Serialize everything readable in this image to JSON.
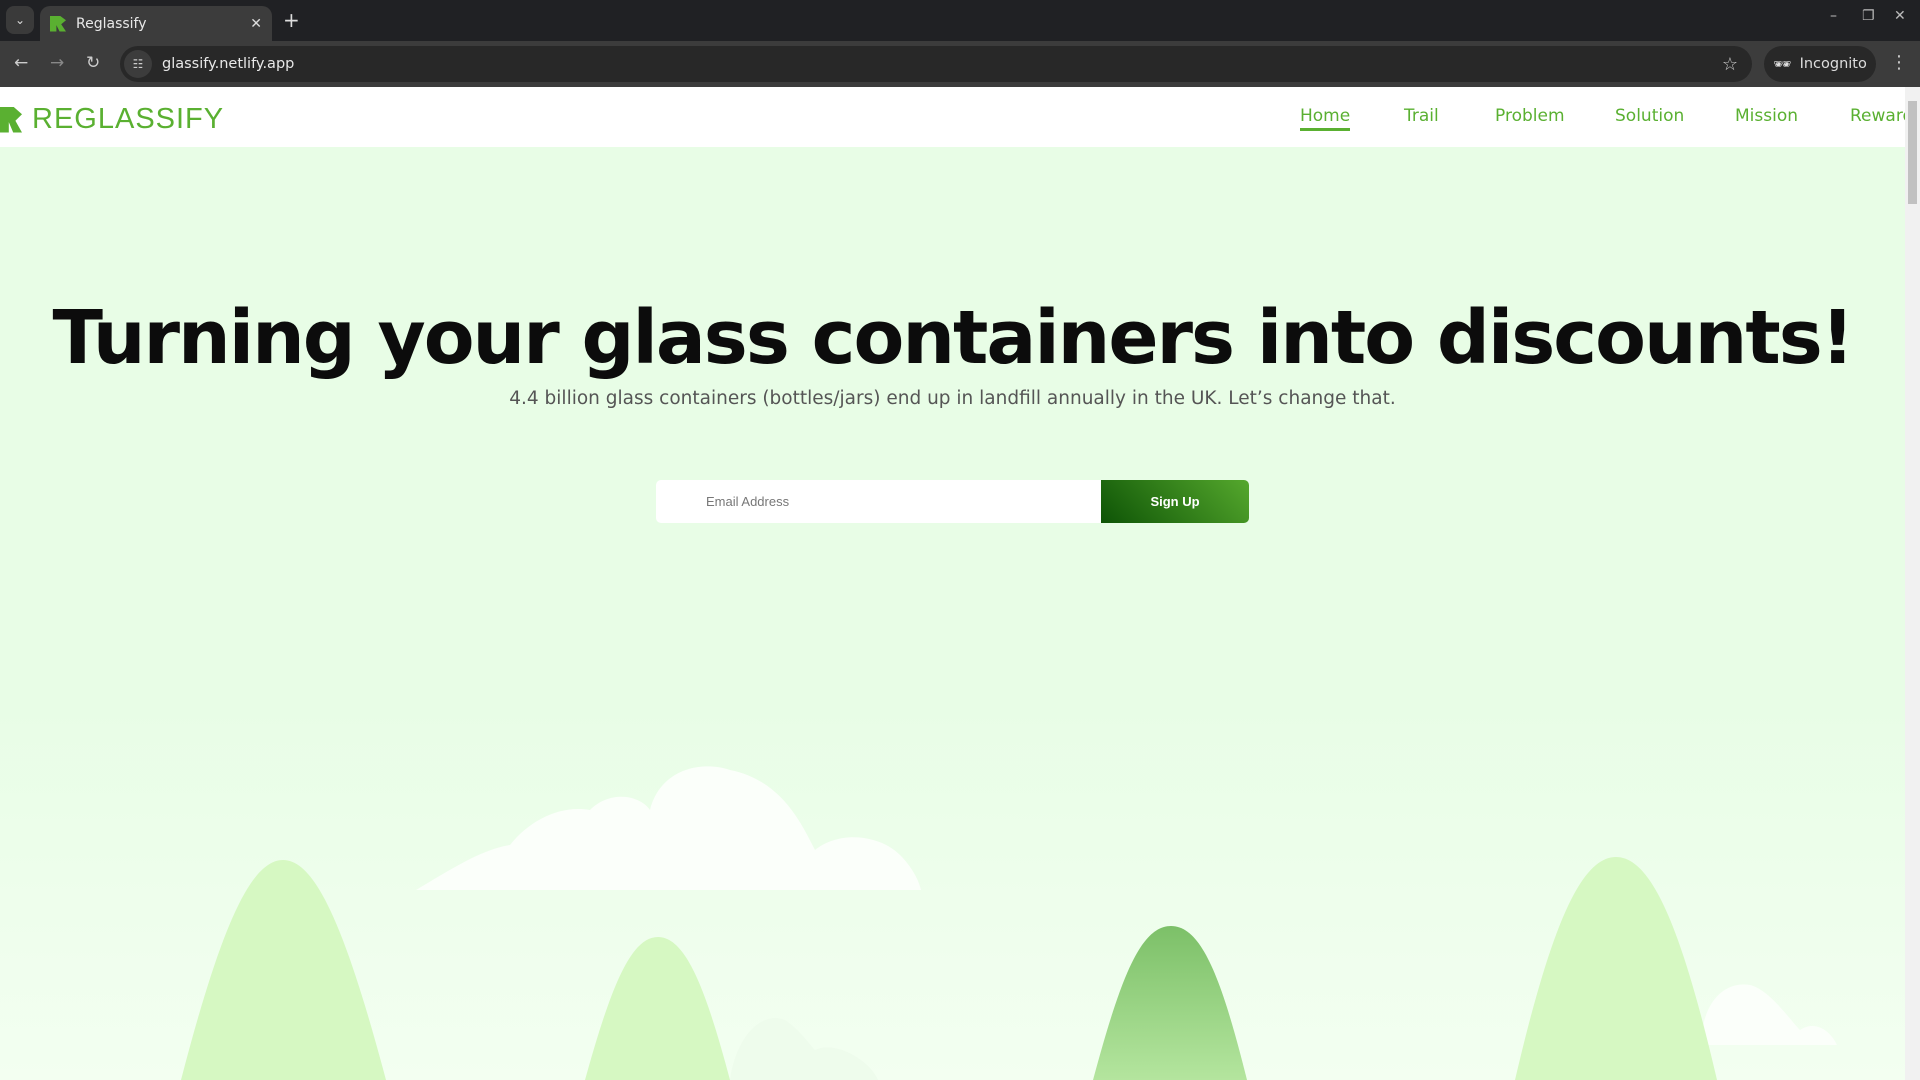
{
  "browser": {
    "tab_title": "Reglassify",
    "url": "glassify.netlify.app",
    "incognito_label": "Incognito"
  },
  "header": {
    "logo_text": "REGLASSIFY",
    "nav": [
      "Home",
      "Trail",
      "Problem",
      "Solution",
      "Mission",
      "Reward"
    ],
    "active": "Home"
  },
  "hero": {
    "title": "Turning your glass containers into discounts!",
    "subtitle": "4.4 billion glass containers (bottles/jars) end up in landfill annually in the UK. Let’s change that.",
    "email_placeholder": "Email Address",
    "signup_label": "Sign Up"
  },
  "colors": {
    "brand": "#5ab031",
    "background": "#e8fde6",
    "button_dark": "#0e5406"
  }
}
